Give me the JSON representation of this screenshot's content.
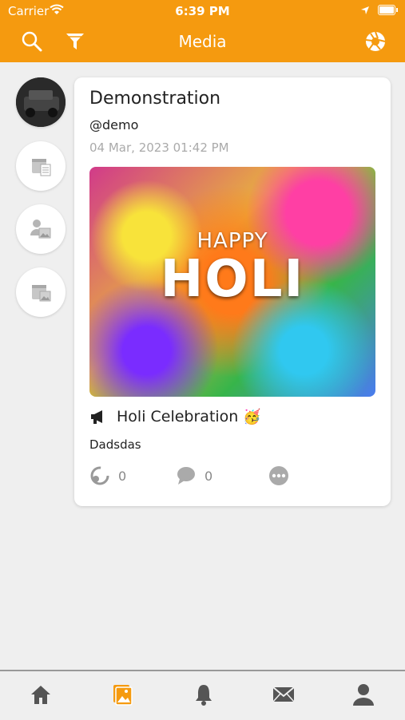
{
  "status_bar": {
    "carrier": "Carrier",
    "time": "6:39 PM"
  },
  "nav": {
    "title": "Media"
  },
  "post": {
    "author_name": "Demonstration",
    "author_handle": "@demo",
    "date": "04 Mar, 2023 01:42 PM",
    "image_text_top": "HAPPY",
    "image_text_main": "HOLI",
    "title": "Holi Celebration",
    "title_emoji": "🥳",
    "caption": "Dadsdas",
    "likes": "0",
    "comments": "0"
  },
  "colors": {
    "accent": "#f59a0f",
    "background": "#efefef"
  },
  "icons": {
    "nav": [
      "search-icon",
      "filter-icon",
      "camera-shutter-icon"
    ],
    "side": [
      "avatar",
      "calendar-document-icon",
      "user-image-icon",
      "calendar-image-icon"
    ],
    "tabs": [
      "home-icon",
      "media-icon",
      "bell-icon",
      "mail-icon",
      "profile-icon"
    ]
  }
}
